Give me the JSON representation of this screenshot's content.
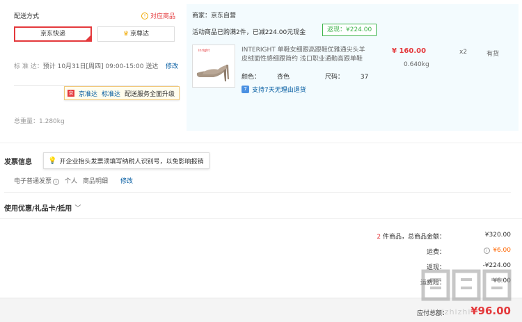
{
  "shipping": {
    "title": "配送方式",
    "match_link": "对应商品",
    "options": [
      "京东快递",
      "京尊达"
    ],
    "delivery_label": "标 准 达：",
    "delivery_value": "预计 10月31日[周四] 09:00-15:00 送达",
    "edit": "修改",
    "tip_logo": "京",
    "tip_brand": "京准达",
    "tip_link": "标准达",
    "tip_text": "配送服务全面升级",
    "weight_label": "总重量：",
    "weight_value": "1.280kg"
  },
  "goods": {
    "seller_label": "商家：",
    "seller": "京东自营",
    "promo": "活动商品已购满2件，已减224.00元现金",
    "rebate": "返现：¥224.00",
    "image_text": "inright",
    "name": "INTERIGHT 单鞋女细跟高跟鞋优雅通尖头羊皮绒面性感细跟简约 浅口职业通勤高跟单鞋",
    "price": "¥ 160.00",
    "weight": "0.640kg",
    "qty": "x2",
    "stock": "有货",
    "color_label": "颜色：",
    "color": "杏色",
    "size_label": "尺码：",
    "size": "37",
    "return_icon": "7",
    "return_text": "支持7天无理由退货"
  },
  "invoice": {
    "title": "发票信息",
    "tip": "开企业抬头发票须填写纳税人识别号，以免影响报销",
    "type": "电子普通发票",
    "owner": "个人",
    "content": "商品明细",
    "edit": "修改"
  },
  "coupon": {
    "title": "使用优惠/礼品卡/抵用",
    "chevron": "﹀"
  },
  "summary": {
    "count": "2",
    "count_suffix": " 件商品，总商品金额：",
    "total": "¥320.00",
    "freight_label": "运费：",
    "freight": "¥6.00",
    "rebate_label": "返现：",
    "rebate": "-¥224.00",
    "service_label": "运费险：",
    "service": "¥6.00",
    "payable_label": "应付总额：",
    "payable": "¥96.00"
  },
  "watermark": {
    "text": "zhizhizhi"
  },
  "colors": {
    "accent": "#e4393c",
    "link": "#005aa0",
    "green": "#3db34a",
    "orange": "#ff6600"
  }
}
